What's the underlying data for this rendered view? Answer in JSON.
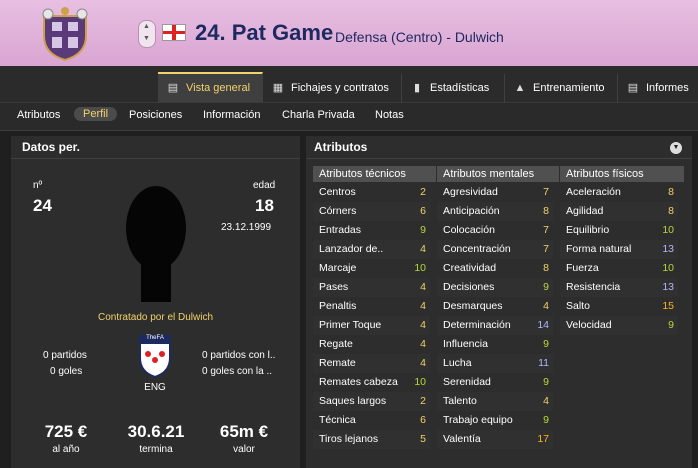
{
  "header": {
    "player_name": "24. Pat Game",
    "subtitle": "Defensa (Centro) - Dulwich",
    "nation_flag_icon": "england-flag-icon",
    "crest_icon": "club-crest-icon"
  },
  "tabs": [
    {
      "label": "Vista general",
      "icon": "person-card-icon",
      "active": true
    },
    {
      "label": "Fichajes y contratos",
      "icon": "document-icon"
    },
    {
      "label": "Estadísticas",
      "icon": "bar-chart-icon"
    },
    {
      "label": "Entrenamiento",
      "icon": "training-cone-icon"
    },
    {
      "label": "Informes",
      "icon": "report-icon"
    }
  ],
  "subnav": [
    {
      "label": "Atributos"
    },
    {
      "label": "Perfil",
      "active": true
    },
    {
      "label": "Posiciones"
    },
    {
      "label": "Información"
    },
    {
      "label": "Charla Privada"
    },
    {
      "label": "Notas"
    }
  ],
  "personal": {
    "title": "Datos per.",
    "number_label": "nº",
    "number": "24",
    "age_label": "edad",
    "age": "18",
    "dob": "23.12.1999",
    "contract_note": "Contratado por el Dulwich",
    "club_matches": "0 partidos",
    "club_goals": "0 goles",
    "intl_matches": "0 partidos con l..",
    "intl_goals": "0 goles con la ..",
    "nation_code": "ENG",
    "wage": "725 €",
    "wage_label": "al año",
    "contract_end": "30.6.21",
    "contract_end_label": "termina",
    "value": "65m €",
    "value_label": "valor",
    "badge_text": "TheFA"
  },
  "attributes": {
    "title": "Atributos",
    "technical": {
      "header": "Atributos técnicos",
      "rows": [
        {
          "name": "Centros",
          "value": "2"
        },
        {
          "name": "Córners",
          "value": "6"
        },
        {
          "name": "Entradas",
          "value": "9"
        },
        {
          "name": "Lanzador de..",
          "value": "4"
        },
        {
          "name": "Marcaje",
          "value": "10"
        },
        {
          "name": "Pases",
          "value": "4"
        },
        {
          "name": "Penaltis",
          "value": "4"
        },
        {
          "name": "Primer Toque",
          "value": "4"
        },
        {
          "name": "Regate",
          "value": "4"
        },
        {
          "name": "Remate",
          "value": "4"
        },
        {
          "name": "Remates cabeza",
          "value": "10"
        },
        {
          "name": "Saques largos",
          "value": "2"
        },
        {
          "name": "Técnica",
          "value": "6"
        },
        {
          "name": "Tiros lejanos",
          "value": "5"
        }
      ]
    },
    "mental": {
      "header": "Atributos mentales",
      "rows": [
        {
          "name": "Agresividad",
          "value": "7"
        },
        {
          "name": "Anticipación",
          "value": "8"
        },
        {
          "name": "Colocación",
          "value": "7"
        },
        {
          "name": "Concentración",
          "value": "7"
        },
        {
          "name": "Creatividad",
          "value": "8"
        },
        {
          "name": "Decisiones",
          "value": "9"
        },
        {
          "name": "Desmarques",
          "value": "4"
        },
        {
          "name": "Determinación",
          "value": "14"
        },
        {
          "name": "Influencia",
          "value": "9"
        },
        {
          "name": "Lucha",
          "value": "11"
        },
        {
          "name": "Serenidad",
          "value": "9"
        },
        {
          "name": "Talento",
          "value": "4"
        },
        {
          "name": "Trabajo equipo",
          "value": "9"
        },
        {
          "name": "Valentía",
          "value": "17"
        }
      ]
    },
    "physical": {
      "header": "Atributos físicos",
      "rows": [
        {
          "name": "Aceleración",
          "value": "8"
        },
        {
          "name": "Agilidad",
          "value": "8"
        },
        {
          "name": "Equilibrio",
          "value": "10"
        },
        {
          "name": "Forma natural",
          "value": "13"
        },
        {
          "name": "Fuerza",
          "value": "10"
        },
        {
          "name": "Resistencia",
          "value": "13"
        },
        {
          "name": "Salto",
          "value": "15"
        },
        {
          "name": "Velocidad",
          "value": "9"
        }
      ]
    },
    "colors": {
      "low": "#f2d36a",
      "mid": "#b9d83a",
      "high": "#b5b5ff",
      "top": "#ffb31c"
    }
  }
}
